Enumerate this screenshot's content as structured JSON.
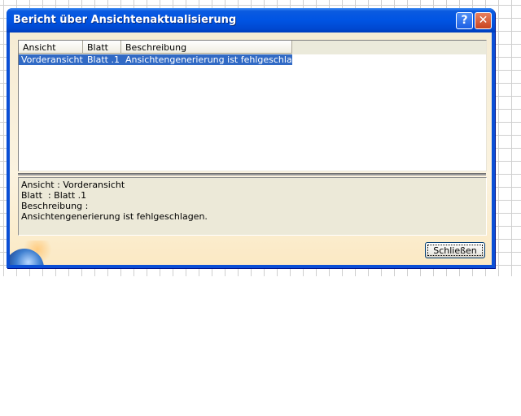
{
  "window": {
    "title": "Bericht über Ansichtenaktualisierung",
    "help_glyph": "?",
    "close_glyph": "✕"
  },
  "table": {
    "columns": [
      "Ansicht",
      "Blatt",
      "Beschreibung"
    ],
    "rows": [
      {
        "ansicht": "Vorderansicht",
        "blatt": "Blatt .1",
        "beschreibung": "Ansichtengenerierung ist fehlgeschlagen.",
        "selected": true
      }
    ]
  },
  "details": {
    "line1": "Ansicht : Vorderansicht",
    "line2": "Blatt  : Blatt .1",
    "line3": "Beschreibung :",
    "line4": "Ansichtengenerierung ist fehlgeschlagen."
  },
  "buttons": {
    "close_label": "Schließen"
  },
  "colors": {
    "titlebar": "#0054e3",
    "selection": "#316ac5",
    "client_bg": "#f6ecd4"
  }
}
